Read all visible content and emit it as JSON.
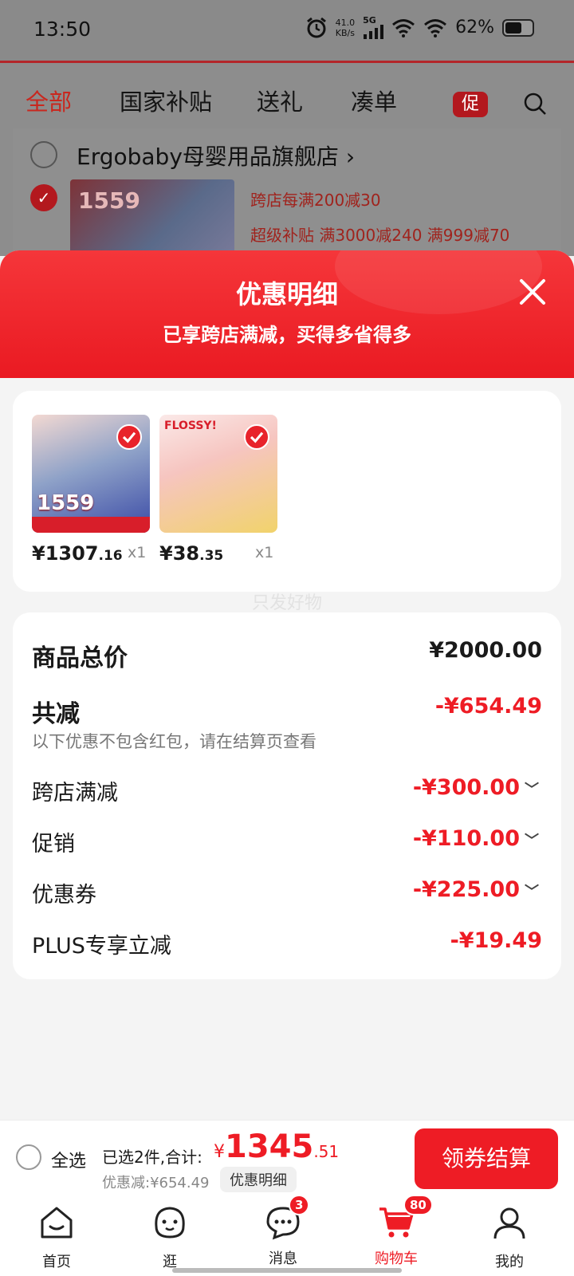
{
  "status_bar": {
    "time": "13:50",
    "net_speed_value": "41.0",
    "net_speed_unit": "KB/s",
    "network": "5G",
    "battery_percent": "62%",
    "battery_level": 0.62
  },
  "background_page": {
    "tabs": [
      "全部",
      "国家补贴",
      "送礼",
      "凑单"
    ],
    "promo_badge": "促",
    "store_name": "Ergobaby母婴用品旗舰店",
    "store_chevron": "›",
    "thumb_price": "1559",
    "offers": [
      "跨店每满200减30",
      "超级补贴 满3000减240   满999减70"
    ]
  },
  "modal": {
    "title": "优惠明细",
    "subtitle": "已享跨店满减，买得多省得多",
    "items": [
      {
        "thumb_text": "1559",
        "price_symbol": "¥",
        "price_int": "1307",
        "price_dec": ".16",
        "qty": "x1"
      },
      {
        "thumb_text": "FLOSSY!",
        "price_symbol": "¥",
        "price_int": "38",
        "price_dec": ".35",
        "qty": "x1"
      }
    ],
    "watermark": "只发好物",
    "summary": {
      "total_label": "商品总价",
      "total_value": "¥2000.00",
      "reduction_label": "共减",
      "reduction_value": "-¥654.49",
      "note": "以下优惠不包含红包，请在结算页查看",
      "rows": [
        {
          "label": "跨店满减",
          "value": "-¥300.00"
        },
        {
          "label": "促销",
          "value": "-¥110.00"
        },
        {
          "label": "优惠券",
          "value": "-¥225.00"
        },
        {
          "label": "PLUS专享立减",
          "value": "-¥19.49"
        }
      ]
    }
  },
  "checkout": {
    "select_all": "全选",
    "selected_text": "已选2件,合计:",
    "currency": "¥",
    "total_int": "1345",
    "total_dec": ".51",
    "discount_text": "优惠减:¥654.49",
    "detail_tag": "优惠明细",
    "button": "领券结算"
  },
  "tab_bar": {
    "tabs": [
      {
        "label": "首页",
        "icon": "home-icon"
      },
      {
        "label": "逛",
        "icon": "browse-face-icon"
      },
      {
        "label": "消息",
        "icon": "message-icon",
        "badge": "3"
      },
      {
        "label": "购物车",
        "icon": "cart-icon",
        "badge": "80"
      },
      {
        "label": "我的",
        "icon": "profile-icon"
      }
    ]
  },
  "colors": {
    "accent_red": "#ee1c25",
    "header_red": "#f5363a"
  }
}
